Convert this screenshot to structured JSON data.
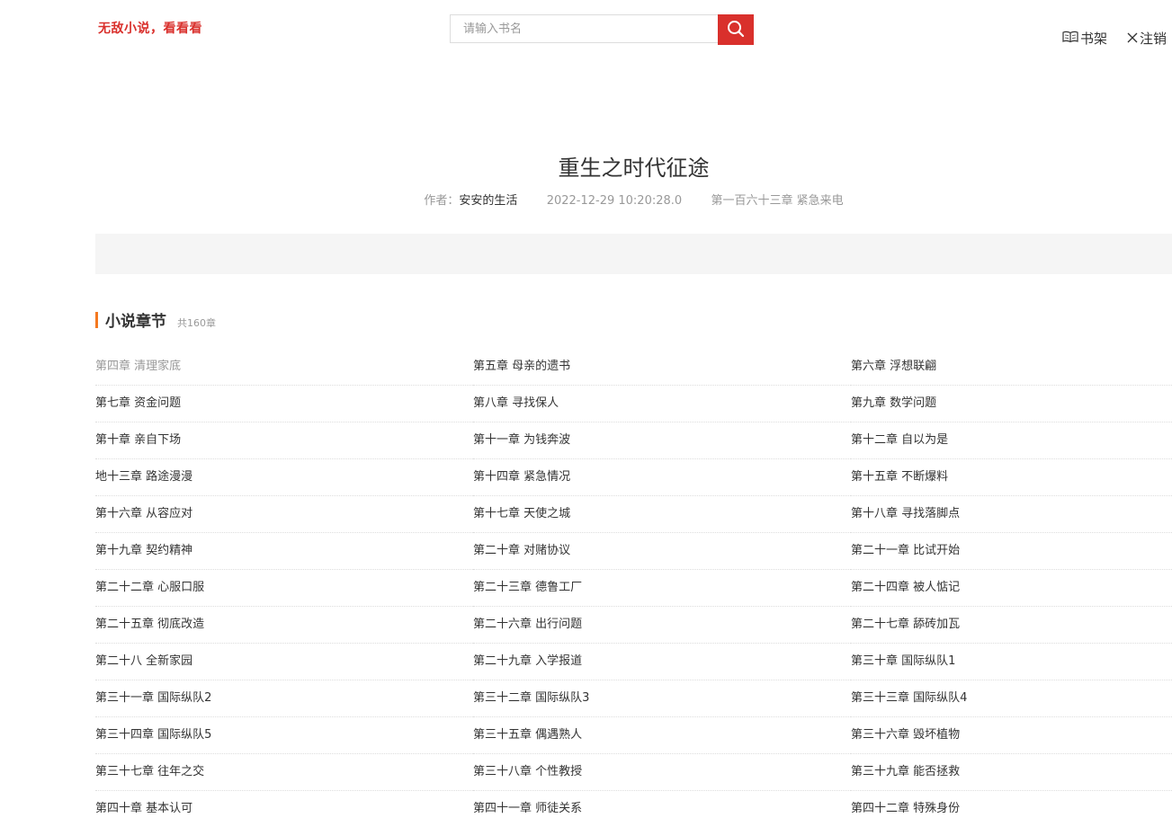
{
  "header": {
    "logo_text": "无敌小说，看看看",
    "search_placeholder": "请输入书名",
    "bookshelf_label": "书架",
    "logout_label": "注销"
  },
  "book": {
    "title": "重生之时代征途",
    "author_label": "作者：",
    "author": "安安的生活",
    "update_time": "2022-12-29 10:20:28.0",
    "latest_chapter": "第一百六十三章 紧急来电"
  },
  "chapters_section": {
    "title": "小说章节",
    "count_text": "共160章"
  },
  "chapters": [
    "第四章 清理家底",
    "第五章 母亲的遗书",
    "第六章 浮想联翩",
    "第七章 资金问题",
    "第八章 寻找保人",
    "第九章 数学问题",
    "第十章 亲自下场",
    "第十一章 为钱奔波",
    "第十二章 自以为是",
    "地十三章 路途漫漫",
    "第十四章 紧急情况",
    "第十五章 不断爆料",
    "第十六章 从容应对",
    "第十七章 天使之城",
    "第十八章 寻找落脚点",
    "第十九章 契约精神",
    "第二十章 对赌协议",
    "第二十一章 比试开始",
    "第二十二章 心服口服",
    "第二十三章 德鲁工厂",
    "第二十四章 被人惦记",
    "第二十五章 彻底改造",
    "第二十六章 出行问题",
    "第二十七章 舔砖加瓦",
    "第二十八 全新家园",
    "第二十九章 入学报道",
    "第三十章 国际纵队1",
    "第三十一章 国际纵队2",
    "第三十二章 国际纵队3",
    "第三十三章 国际纵队4",
    "第三十四章 国际纵队5",
    "第三十五章 偶遇熟人",
    "第三十六章 毁坏植物",
    "第三十七章 往年之交",
    "第三十八章 个性教授",
    "第三十九章 能否拯救",
    "第四十章 基本认可",
    "第四十一章 师徒关系",
    "第四十二章 特殊身份"
  ],
  "colors": {
    "accent_red": "#d9302c",
    "section_bar_orange": "#f47920",
    "read_chapter_grey": "#999999"
  }
}
